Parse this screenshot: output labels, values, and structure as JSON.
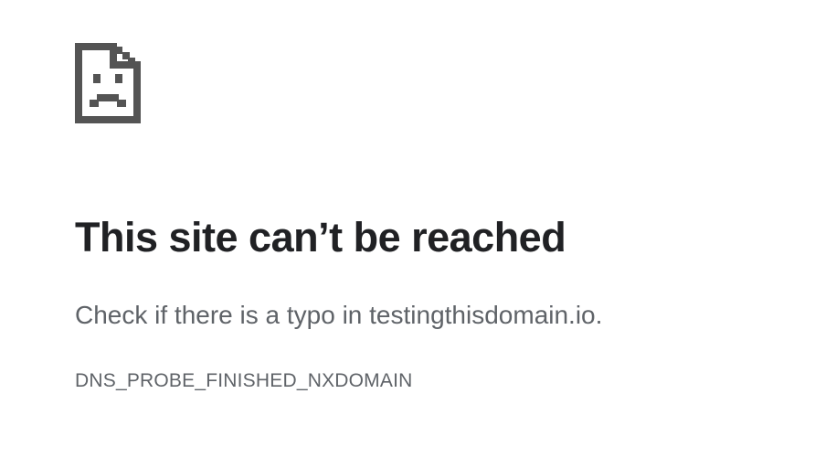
{
  "error": {
    "icon": "sad-page-icon",
    "title": "This site can’t be reached",
    "message": "Check if there is a typo in testingthisdomain.io.",
    "code": "DNS_PROBE_FINISHED_NXDOMAIN"
  },
  "colors": {
    "icon": "#545454",
    "title": "#202124",
    "body_text": "#5f6368",
    "background": "#ffffff"
  }
}
